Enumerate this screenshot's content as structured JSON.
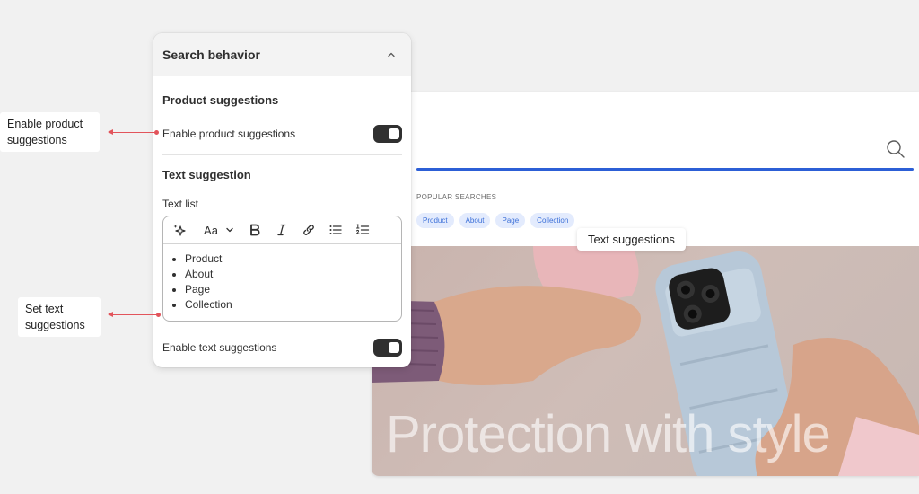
{
  "storefront": {
    "popular_title": "POPULAR SEARCHES",
    "chips": [
      "Product",
      "About",
      "Page",
      "Collection"
    ],
    "hero_title": "Protection with style",
    "tooltip": "Text suggestions"
  },
  "panel": {
    "title": "Search behavior",
    "product_section_title": "Product suggestions",
    "enable_product_label": "Enable product suggestions",
    "enable_product_on": true,
    "text_section_title": "Text suggestion",
    "text_list_label": "Text list",
    "text_list_items": [
      "Product",
      "About",
      "Page",
      "Collection"
    ],
    "enable_text_label": "Enable text suggestions",
    "enable_text_on": true,
    "toolbar_font_glyph": "Aa"
  },
  "annotations": {
    "product": "Enable product suggestions",
    "text": "Set text suggestions"
  },
  "colors": {
    "accent": "#2c5fd6",
    "chip_bg": "#e3ebfd",
    "annotation_arrow": "#e2545b",
    "toggle_on": "#303030"
  }
}
